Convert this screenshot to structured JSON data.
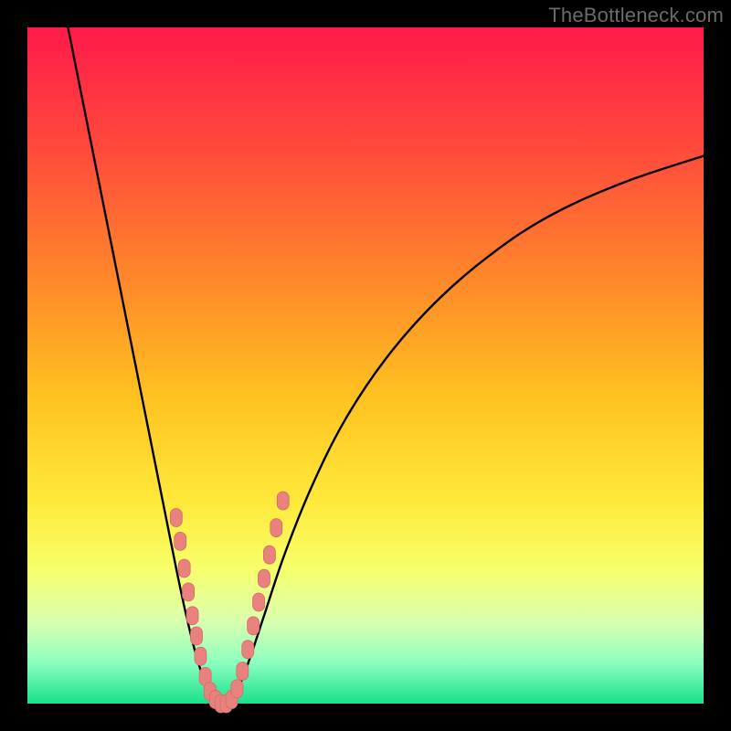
{
  "watermark": {
    "text": "TheBottleneck.com"
  },
  "colors": {
    "frame": "#000000",
    "gradient_stops": [
      {
        "pct": 0,
        "color": "#ff1a4b"
      },
      {
        "pct": 18,
        "color": "#ff4a3c"
      },
      {
        "pct": 38,
        "color": "#ff8a2a"
      },
      {
        "pct": 55,
        "color": "#ffc321"
      },
      {
        "pct": 70,
        "color": "#ffe93a"
      },
      {
        "pct": 80,
        "color": "#f7ff6a"
      },
      {
        "pct": 88,
        "color": "#d8ffb0"
      },
      {
        "pct": 94,
        "color": "#8affc0"
      },
      {
        "pct": 100,
        "color": "#18e08a"
      }
    ],
    "curve": "#000000",
    "marker_fill": "#e9827e",
    "marker_stroke": "#d46b66"
  },
  "chart_data": {
    "type": "line",
    "title": "",
    "xlabel": "",
    "ylabel": "",
    "xlim": [
      0,
      100
    ],
    "ylim": [
      0,
      100
    ],
    "series": [
      {
        "name": "left-branch",
        "x": [
          6,
          8,
          10,
          12,
          14,
          16,
          18,
          20,
          22,
          23.5,
          25,
          26.5,
          28
        ],
        "y": [
          100,
          90,
          80,
          70,
          60,
          50,
          40,
          30,
          20,
          13,
          7,
          2.5,
          0
        ]
      },
      {
        "name": "right-branch",
        "x": [
          30,
          31.5,
          33,
          35,
          38,
          42,
          47,
          53,
          60,
          68,
          77,
          88,
          100
        ],
        "y": [
          0,
          3,
          7,
          13,
          22,
          32,
          42,
          51,
          59,
          66,
          72,
          77,
          81
        ]
      }
    ],
    "markers": [
      {
        "series": "left-branch",
        "x": 22.0,
        "y": 27.5
      },
      {
        "series": "left-branch",
        "x": 22.6,
        "y": 24.0
      },
      {
        "series": "left-branch",
        "x": 23.2,
        "y": 20.0
      },
      {
        "series": "left-branch",
        "x": 23.8,
        "y": 16.5
      },
      {
        "series": "left-branch",
        "x": 24.4,
        "y": 13.0
      },
      {
        "series": "left-branch",
        "x": 25.0,
        "y": 10.0
      },
      {
        "series": "left-branch",
        "x": 25.6,
        "y": 7.0
      },
      {
        "series": "left-branch",
        "x": 26.3,
        "y": 4.0
      },
      {
        "series": "left-branch",
        "x": 27.0,
        "y": 1.8
      },
      {
        "series": "left-branch",
        "x": 27.8,
        "y": 0.6
      },
      {
        "series": "valley",
        "x": 28.6,
        "y": 0.0
      },
      {
        "series": "valley",
        "x": 29.4,
        "y": 0.0
      },
      {
        "series": "right-branch",
        "x": 30.2,
        "y": 0.6
      },
      {
        "series": "right-branch",
        "x": 31.0,
        "y": 2.2
      },
      {
        "series": "right-branch",
        "x": 31.8,
        "y": 4.8
      },
      {
        "series": "right-branch",
        "x": 32.6,
        "y": 8.0
      },
      {
        "series": "right-branch",
        "x": 33.4,
        "y": 11.5
      },
      {
        "series": "right-branch",
        "x": 34.2,
        "y": 15.0
      },
      {
        "series": "right-branch",
        "x": 35.0,
        "y": 18.5
      },
      {
        "series": "right-branch",
        "x": 35.8,
        "y": 22.0
      },
      {
        "series": "right-branch",
        "x": 36.8,
        "y": 26.0
      },
      {
        "series": "right-branch",
        "x": 37.8,
        "y": 30.0
      }
    ]
  }
}
